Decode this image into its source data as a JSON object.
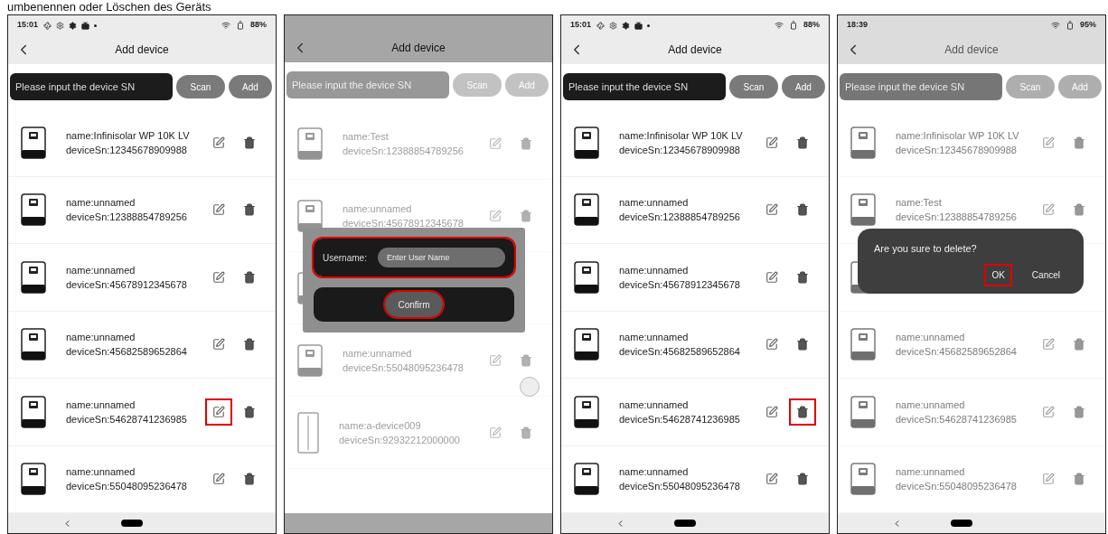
{
  "caption": "umbenennen oder Löschen des Geräts",
  "screens": [
    {
      "status_bar": {
        "time": "15:01",
        "battery": "88%",
        "notification_icons": true
      },
      "dimmed": false,
      "title": "Add device",
      "search_placeholder": "Please input the device SN",
      "scan": "Scan",
      "add": "Add",
      "floating_button": false,
      "nav_icons": true,
      "devices": [
        {
          "kind": "inverter",
          "name": "name:Infinisolar WP 10K LV",
          "sn": "deviceSn:12345678909988",
          "edit_highlighted": false,
          "delete_highlighted": false
        },
        {
          "kind": "inverter",
          "name": "name:unnamed",
          "sn": "deviceSn:12388854789256",
          "edit_highlighted": false,
          "delete_highlighted": false
        },
        {
          "kind": "inverter",
          "name": "name:unnamed",
          "sn": "deviceSn:45678912345678",
          "edit_highlighted": false,
          "delete_highlighted": false
        },
        {
          "kind": "inverter",
          "name": "name:unnamed",
          "sn": "deviceSn:45682589652864",
          "edit_highlighted": false,
          "delete_highlighted": false
        },
        {
          "kind": "inverter",
          "name": "name:unnamed",
          "sn": "deviceSn:54628741236985",
          "edit_highlighted": true,
          "delete_highlighted": false
        },
        {
          "kind": "inverter",
          "name": "name:unnamed",
          "sn": "deviceSn:55048095236478",
          "edit_highlighted": false,
          "delete_highlighted": false
        }
      ]
    },
    {
      "dimmed": true,
      "title": "Add device",
      "search_placeholder": "Please input the device SN",
      "scan": "Scan",
      "add": "Add",
      "floating_button": true,
      "nav_icons": false,
      "devices": [
        {
          "kind": "inverter",
          "name": "name:Test",
          "sn": "deviceSn:12388854789256",
          "edit_highlighted": false,
          "delete_highlighted": false
        },
        {
          "kind": "inverter",
          "name": "name:unnamed",
          "sn": "deviceSn:45678912345678",
          "edit_highlighted": false,
          "delete_highlighted": false
        },
        {
          "kind": "covered"
        },
        {
          "kind": "inverter",
          "name": "name:unnamed",
          "sn": "deviceSn:55048095236478",
          "edit_highlighted": false,
          "delete_highlighted": false
        },
        {
          "kind": "tall-unit",
          "name": "name:a-device009",
          "sn": "deviceSn:92932212000000",
          "edit_highlighted": false,
          "delete_highlighted": false
        }
      ],
      "dialog": {
        "kind": "rename",
        "label": "Username:",
        "placeholder": "Enter User Name",
        "button": "Confirm",
        "field_highlighted": true,
        "button_highlighted": true
      }
    },
    {
      "status_bar": {
        "time": "15:01",
        "battery": "88%",
        "notification_icons": true
      },
      "dimmed": false,
      "title": "Add device",
      "search_placeholder": "Please input the device SN",
      "scan": "Scan",
      "add": "Add",
      "floating_button": false,
      "nav_icons": true,
      "devices": [
        {
          "kind": "inverter",
          "name": "name:Infinisolar WP 10K LV",
          "sn": "deviceSn:12345678909988",
          "edit_highlighted": false,
          "delete_highlighted": false
        },
        {
          "kind": "inverter",
          "name": "name:unnamed",
          "sn": "deviceSn:12388854789256",
          "edit_highlighted": false,
          "delete_highlighted": false
        },
        {
          "kind": "inverter",
          "name": "name:unnamed",
          "sn": "deviceSn:45678912345678",
          "edit_highlighted": false,
          "delete_highlighted": false
        },
        {
          "kind": "inverter",
          "name": "name:unnamed",
          "sn": "deviceSn:45682589652864",
          "edit_highlighted": false,
          "delete_highlighted": false
        },
        {
          "kind": "inverter",
          "name": "name:unnamed",
          "sn": "deviceSn:54628741236985",
          "edit_highlighted": false,
          "delete_highlighted": true
        },
        {
          "kind": "inverter",
          "name": "name:unnamed",
          "sn": "deviceSn:55048095236478",
          "edit_highlighted": false,
          "delete_highlighted": false
        }
      ]
    },
    {
      "status_bar": {
        "time": "18:39",
        "battery": "95%",
        "notification_icons": false
      },
      "dimmed": true,
      "title": "Add device",
      "search_placeholder": "Please input the device SN",
      "scan": "Scan",
      "add": "Add",
      "floating_button": false,
      "nav_icons": true,
      "devices": [
        {
          "kind": "inverter",
          "name": "name:Infinisolar WP 10K LV",
          "sn": "deviceSn:12345678909988",
          "edit_highlighted": false,
          "delete_highlighted": false
        },
        {
          "kind": "inverter",
          "name": "name:Test",
          "sn": "deviceSn:12388854789256",
          "edit_highlighted": false,
          "delete_highlighted": false
        },
        {
          "kind": "covered"
        },
        {
          "kind": "inverter",
          "name": "name:unnamed",
          "sn": "deviceSn:45682589652864",
          "edit_highlighted": false,
          "delete_highlighted": false
        },
        {
          "kind": "inverter",
          "name": "name:unnamed",
          "sn": "deviceSn:54628741236985",
          "edit_highlighted": false,
          "delete_highlighted": false
        },
        {
          "kind": "inverter",
          "name": "name:unnamed",
          "sn": "deviceSn:55048095236478",
          "edit_highlighted": false,
          "delete_highlighted": false
        }
      ],
      "dialog": {
        "kind": "confirm",
        "message": "Are you sure to delete?",
        "buttons": [
          {
            "label": "OK",
            "highlighted": true
          },
          {
            "label": "Cancel",
            "highlighted": false
          }
        ]
      }
    }
  ]
}
